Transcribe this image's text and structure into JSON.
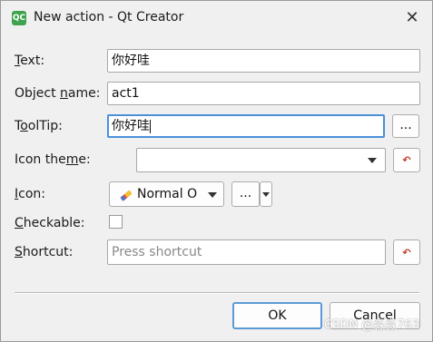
{
  "window": {
    "icon_text": "QC",
    "title": "New action - Qt Creator",
    "close_glyph": "✕"
  },
  "form": {
    "text": {
      "label_u": "T",
      "label_rest": "ext:",
      "value": "你好哇"
    },
    "object_name": {
      "label_pre": "Object ",
      "label_u": "n",
      "label_rest": "ame:",
      "value": "act1"
    },
    "tooltip": {
      "label_pre": "T",
      "label_u": "o",
      "label_rest": "olTip:",
      "value": "你好哇",
      "more_label": "..."
    },
    "icon_theme": {
      "label_pre": "Icon the",
      "label_u": "m",
      "label_rest": "e:",
      "value": ""
    },
    "icon": {
      "label_u": "I",
      "label_rest": "con:",
      "mode_value": "Normal O",
      "more_label": "..."
    },
    "checkable": {
      "label_u": "C",
      "label_rest": "heckable:",
      "checked": false
    },
    "shortcut": {
      "label_u": "S",
      "label_rest": "hortcut:",
      "placeholder": "Press shortcut"
    }
  },
  "buttons": {
    "ok": "OK",
    "cancel": "Cancel"
  },
  "watermark": "CSDN @淼淼763",
  "icons": {
    "reset": "reset-arrow-icon",
    "pencil": "pencil-icon",
    "dropdown": "chevron-down-icon"
  },
  "colors": {
    "focus_border": "#4a90d9",
    "ok_border": "#5b9bd5",
    "reset_icon": "#c0392b"
  }
}
